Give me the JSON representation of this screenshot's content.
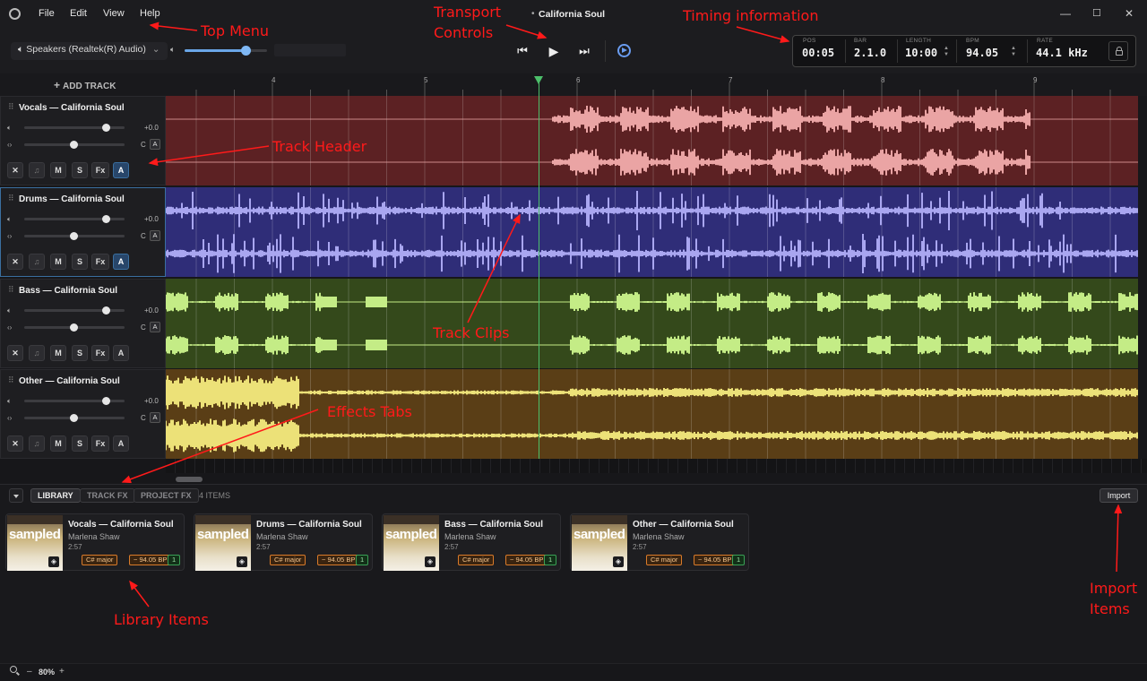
{
  "menu": {
    "file": "File",
    "edit": "Edit",
    "view": "View",
    "help": "Help"
  },
  "window": {
    "title": "California Soul",
    "minimize": "—",
    "maximize": "☐",
    "close": "✕"
  },
  "output": {
    "device": "Speakers (Realtek(R) Audio)",
    "volume": 0.74
  },
  "timing": {
    "pos_label": "POS",
    "pos": "00:05",
    "bar_label": "BAR",
    "bar": "2.1.0",
    "length_label": "LENGTH",
    "length": "10:00",
    "bpm_label": "BPM",
    "bpm": "94.05",
    "rate_label": "RATE",
    "rate": "44.1 kHz"
  },
  "add_track": "ADD TRACK",
  "ruler": [
    "4",
    "5",
    "6",
    "7",
    "8",
    "9"
  ],
  "tracks": [
    {
      "name": "Vocals — California Soul",
      "gain": "+0.0",
      "pan": "C",
      "auto": "A",
      "color": "#5c2123",
      "wave": "#eaa4a4",
      "vol": 0.82,
      "panpos": 0.5,
      "a_on": true
    },
    {
      "name": "Drums — California Soul",
      "gain": "+0.0",
      "pan": "C",
      "auto": "A",
      "color": "#2f2d78",
      "wave": "#a9a6f0",
      "vol": 0.82,
      "panpos": 0.5,
      "a_on": true
    },
    {
      "name": "Bass — California Soul",
      "gain": "+0.0",
      "pan": "C",
      "auto": "A",
      "color": "#34491b",
      "wave": "#c4ec86",
      "vol": 0.82,
      "panpos": 0.5,
      "a_on": false
    },
    {
      "name": "Other — California Soul",
      "gain": "+0.0",
      "pan": "C",
      "auto": "A",
      "color": "#5a3e16",
      "wave": "#ece178",
      "vol": 0.82,
      "panpos": 0.5,
      "a_on": false
    }
  ],
  "btn": {
    "m": "M",
    "s": "S",
    "fx": "Fx",
    "a": "A"
  },
  "tabs": {
    "library": "LIBRARY",
    "track_fx": "TRACK FX",
    "project_fx": "PROJECT FX",
    "count": "4 ITEMS"
  },
  "import": "Import",
  "library": [
    {
      "title": "Vocals — California Soul",
      "artist": "Marlena Shaw",
      "duration": "2:57",
      "key": "C# major",
      "bpm": "~ 94.05 BPM",
      "num": "1",
      "thumb": "sampled"
    },
    {
      "title": "Drums — California Soul",
      "artist": "Marlena Shaw",
      "duration": "2:57",
      "key": "C# major",
      "bpm": "~ 94.05 BPM",
      "num": "1",
      "thumb": "sampled"
    },
    {
      "title": "Bass — California Soul",
      "artist": "Marlena Shaw",
      "duration": "2:57",
      "key": "C# major",
      "bpm": "~ 94.05 BPM",
      "num": "1",
      "thumb": "sampled"
    },
    {
      "title": "Other — California Soul",
      "artist": "Marlena Shaw",
      "duration": "2:57",
      "key": "C# major",
      "bpm": "~ 94.05 BPM",
      "num": "1",
      "thumb": "sampled"
    }
  ],
  "status": {
    "zoom": "80%",
    "minus": "–",
    "plus": "+"
  },
  "annotations": {
    "top_menu": "Top Menu",
    "transport1": "Transport",
    "transport2": "Controls",
    "timing": "Timing information",
    "track_header": "Track Header",
    "track_clips": "Track Clips",
    "effects_tabs": "Effects Tabs",
    "library_items": "Library Items",
    "import1": "Import",
    "import2": "Items"
  },
  "colors": {
    "accent": "#3a6fa0",
    "annotation": "#ff1a1a",
    "playhead": "#4cbf6a"
  }
}
